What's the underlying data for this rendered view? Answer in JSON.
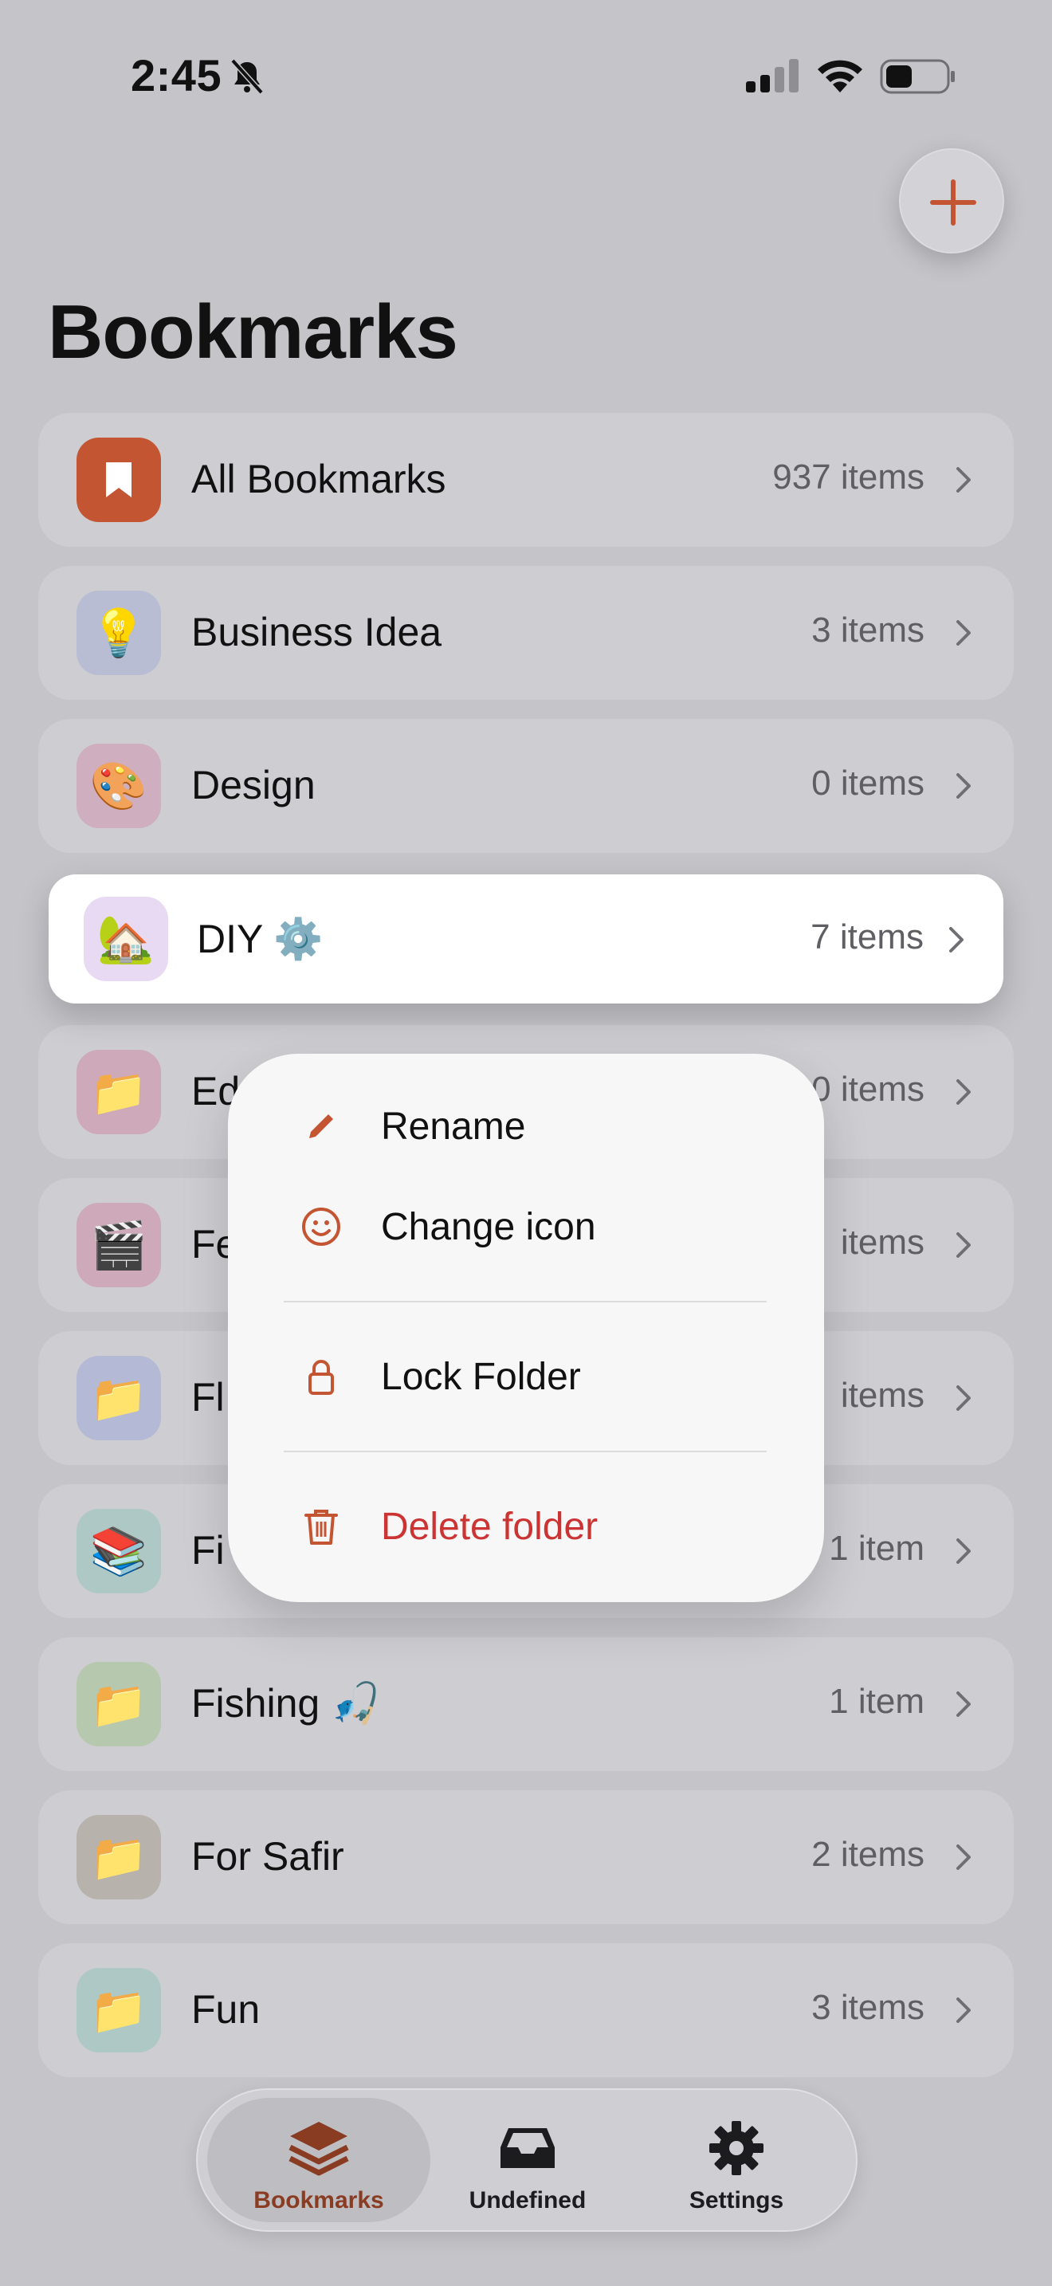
{
  "status_bar": {
    "time": "2:45"
  },
  "header": {
    "title": "Bookmarks"
  },
  "folders": [
    {
      "name": "All Bookmarks",
      "count": "937 items",
      "emoji": "",
      "tile_color": "#c45532"
    },
    {
      "name": "Business Idea",
      "count": "3 items",
      "emoji": "💡",
      "tile_color": "#b8bdd4"
    },
    {
      "name": "Design",
      "count": "0 items",
      "emoji": "🎨",
      "tile_color": "#ceaebf"
    },
    {
      "name": "DIY ⚙️",
      "count": "7 items",
      "emoji": "🏡",
      "tile_color": "#e9daf4"
    },
    {
      "name": "Ed",
      "count": "0 items",
      "emoji": "📁",
      "tile_color": "#cda9ba"
    },
    {
      "name": "Fe",
      "count": "items",
      "emoji": "🎬",
      "tile_color": "#cda9ba"
    },
    {
      "name": "Fl",
      "count": "items",
      "emoji": "📁",
      "tile_color": "#b4bad5"
    },
    {
      "name": "Fi",
      "count": "1 item",
      "emoji": "📚",
      "tile_color": "#aec8c6"
    },
    {
      "name": "Fishing 🎣",
      "count": "1 item",
      "emoji": "📁",
      "tile_color": "#b6c8ad"
    },
    {
      "name": "For Safir",
      "count": "2 items",
      "emoji": "📁",
      "tile_color": "#b7b2ab"
    },
    {
      "name": "Fun",
      "count": "3 items",
      "emoji": "📁",
      "tile_color": "#aec8c6"
    }
  ],
  "context_menu": {
    "rename": "Rename",
    "change_icon": "Change icon",
    "lock_folder": "Lock Folder",
    "delete_folder": "Delete folder"
  },
  "tabbar": {
    "bookmarks": "Bookmarks",
    "undefined": "Undefined",
    "settings": "Settings"
  },
  "colors": {
    "accent": "#c45532",
    "danger": "#cc3333",
    "active_tab_label": "#8a3c22"
  }
}
